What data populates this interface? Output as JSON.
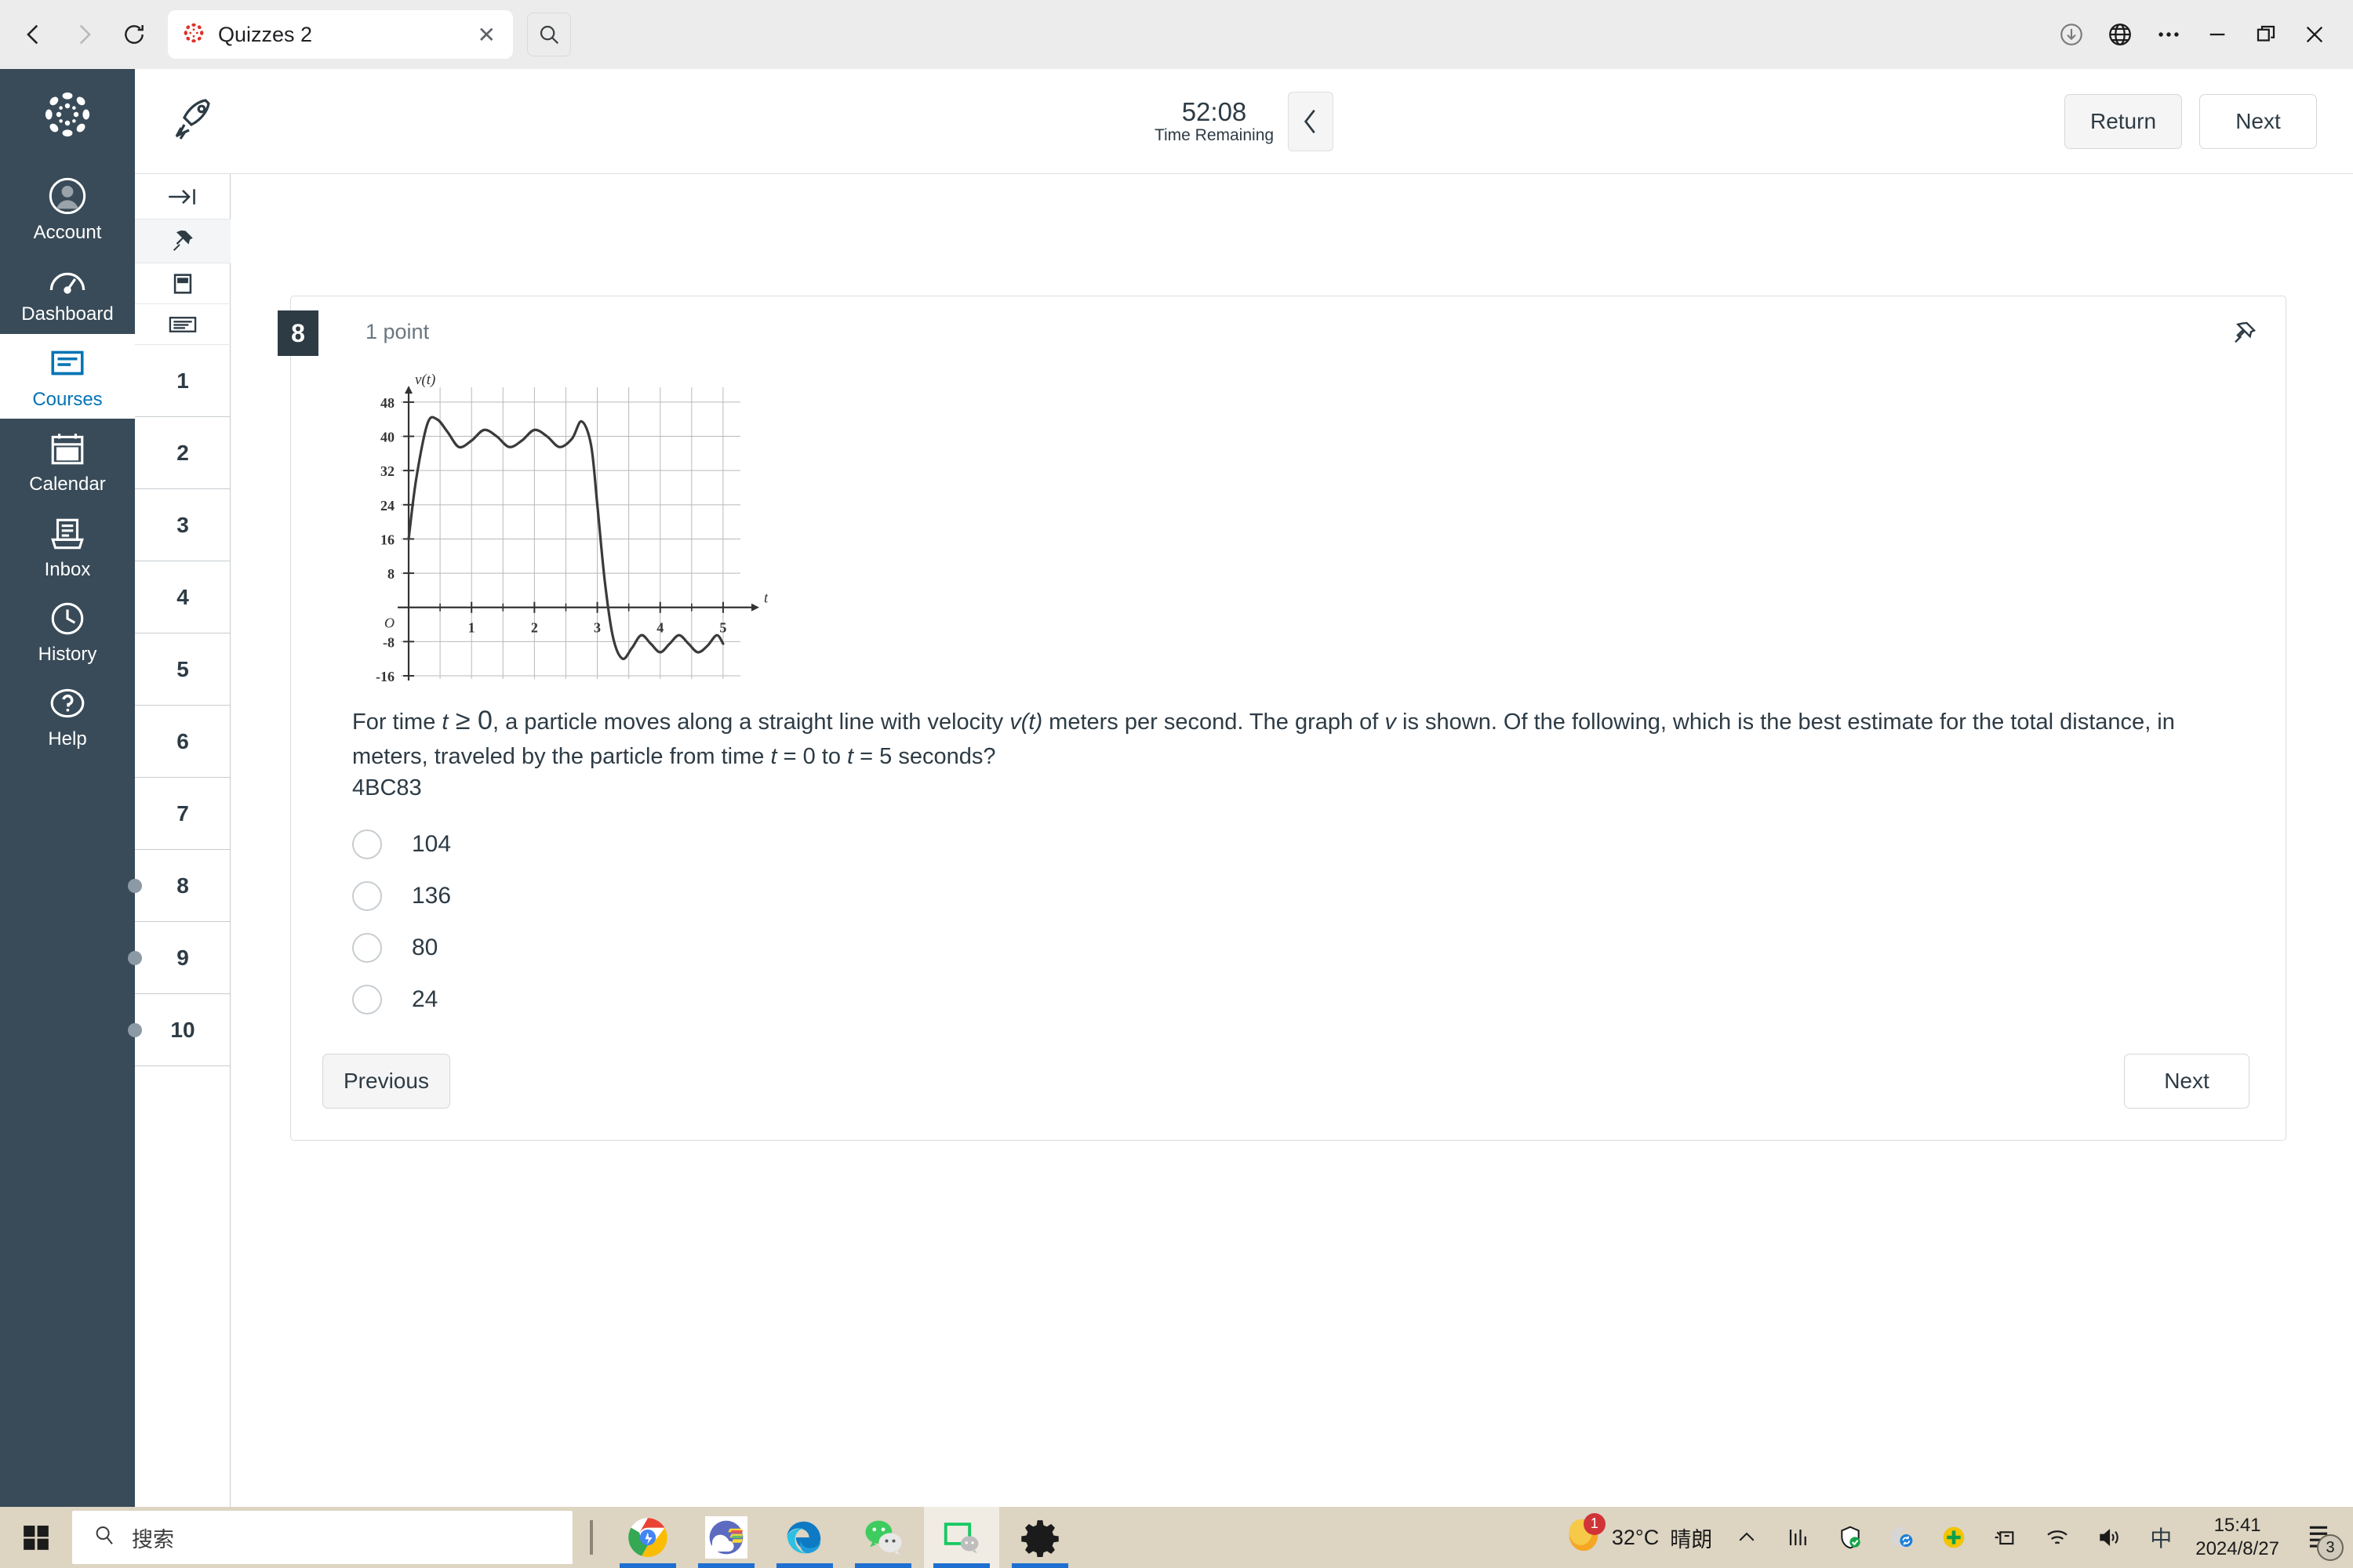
{
  "browser": {
    "back_icon": "back-arrow-icon",
    "forward_icon": "forward-arrow-icon",
    "reload_icon": "reload-icon",
    "tab_title": "Quizzes 2",
    "tab_close_label": "✕",
    "search_icon": "search-icon",
    "downloads_icon": "download-icon",
    "globe_icon": "globe-icon",
    "more_icon": "more-options-icon",
    "minimize_label": "—",
    "maximize_icon": "maximize-icon",
    "close_label": "✕"
  },
  "canvas_nav": {
    "logo_name": "canvas-logo",
    "items": [
      {
        "label": "Account",
        "icon": "user-icon",
        "active": false
      },
      {
        "label": "Dashboard",
        "icon": "dashboard-icon",
        "active": false
      },
      {
        "label": "Courses",
        "icon": "courses-icon",
        "active": true
      },
      {
        "label": "Calendar",
        "icon": "calendar-icon",
        "active": false
      },
      {
        "label": "Inbox",
        "icon": "inbox-icon",
        "active": false
      },
      {
        "label": "History",
        "icon": "clock-icon",
        "active": false
      },
      {
        "label": "Help",
        "icon": "help-icon",
        "active": false
      }
    ],
    "collapse_icon": "collapse-left-icon"
  },
  "question_nav": {
    "icons": [
      "expand-right-icon",
      "pin-icon",
      "flag-card-icon",
      "list-lines-icon"
    ],
    "items": [
      {
        "number": "1",
        "marked": false
      },
      {
        "number": "2",
        "marked": false
      },
      {
        "number": "3",
        "marked": false
      },
      {
        "number": "4",
        "marked": false
      },
      {
        "number": "5",
        "marked": false
      },
      {
        "number": "6",
        "marked": false
      },
      {
        "number": "7",
        "marked": false
      },
      {
        "number": "8",
        "marked": true
      },
      {
        "number": "9",
        "marked": true
      },
      {
        "number": "10",
        "marked": true
      }
    ]
  },
  "quiz_header": {
    "logo_name": "rocket-icon",
    "timer_value": "52:08",
    "timer_label": "Time Remaining",
    "collapse_icon": "chevron-left-icon",
    "return_label": "Return",
    "next_label": "Next"
  },
  "question": {
    "number": "8",
    "points": "1 point",
    "pin_icon": "pin-icon",
    "text_parts": {
      "p1": "For time ",
      "t1": "t",
      "ge": "≥",
      "zero": "0",
      "p2": ", a particle moves along a straight line with velocity ",
      "vt": "v(t)",
      "p3": " meters per second. The graph of ",
      "v": "v",
      "p4": " is shown. Of the following, which is the best estimate for the total distance, in meters, traveled by the particle from time ",
      "t2": "t",
      "p5": " = 0 to ",
      "t3": "t",
      "p6": " = 5 seconds?"
    },
    "code": "4BC83",
    "answers": [
      {
        "label": "104",
        "selected": false
      },
      {
        "label": "136",
        "selected": false
      },
      {
        "label": "80",
        "selected": false
      },
      {
        "label": "24",
        "selected": false
      }
    ],
    "previous_label": "Previous",
    "next_label": "Next"
  },
  "chart_data": {
    "type": "line",
    "title": "",
    "xlabel": "t",
    "ylabel": "v(t)",
    "xlim": [
      0,
      5.4
    ],
    "ylim": [
      -16,
      50
    ],
    "grid": true,
    "xticks": [
      1,
      2,
      3,
      4,
      5
    ],
    "xtick_labels": [
      "1",
      "2",
      "3",
      "4",
      "5"
    ],
    "yticks": [
      -16,
      -8,
      0,
      8,
      16,
      24,
      32,
      40,
      48
    ],
    "ytick_labels": [
      "-16",
      "-8",
      "O",
      "8",
      "16",
      "24",
      "32",
      "40",
      "48"
    ],
    "origin_label": "O",
    "series": [
      {
        "name": "v(t)",
        "x": [
          0,
          0.12,
          0.3,
          0.45,
          0.62,
          0.8,
          1.0,
          1.2,
          1.4,
          1.6,
          1.8,
          2.0,
          2.2,
          2.4,
          2.6,
          2.75,
          2.9,
          3.0,
          3.12,
          3.25,
          3.4,
          3.55,
          3.7,
          3.85,
          4.0,
          4.15,
          4.3,
          4.45,
          4.6,
          4.75,
          4.9,
          5.0
        ],
        "y": [
          16,
          30,
          43,
          44,
          41,
          37.5,
          39,
          41.5,
          40,
          37.5,
          39,
          41.5,
          40,
          37.5,
          39.5,
          43.5,
          38,
          24,
          6,
          -7,
          -12,
          -9.5,
          -6.5,
          -8.5,
          -10.5,
          -8.5,
          -6.5,
          -8.5,
          -10.5,
          -9,
          -6.5,
          -8.5
        ]
      }
    ]
  },
  "taskbar": {
    "start_icon": "windows-start-icon",
    "search_icon": "search-icon",
    "search_placeholder": "搜索",
    "apps": [
      {
        "name": "chrome-icon",
        "active": false
      },
      {
        "name": "weather-app-icon",
        "active": false
      },
      {
        "name": "edge-icon",
        "active": false
      },
      {
        "name": "wechat-icon",
        "active": false
      },
      {
        "name": "green-chat-app-icon",
        "active": true
      },
      {
        "name": "settings-gear-icon",
        "active": false
      }
    ],
    "tray": {
      "battery_icon": "battery-icon",
      "weather_temp": "32°C",
      "weather_desc": "晴朗",
      "weather_badge": "1",
      "chevron_icon": "chevron-up-icon",
      "icons": [
        "network-monitor-icon",
        "security-shield-icon",
        "sync-icon",
        "plus-circle-icon",
        "usb-device-icon",
        "wifi-icon",
        "volume-icon",
        "ime-icon"
      ],
      "ime_label": "中",
      "time": "15:41",
      "date": "2024/8/27",
      "notification_count": "3"
    }
  }
}
